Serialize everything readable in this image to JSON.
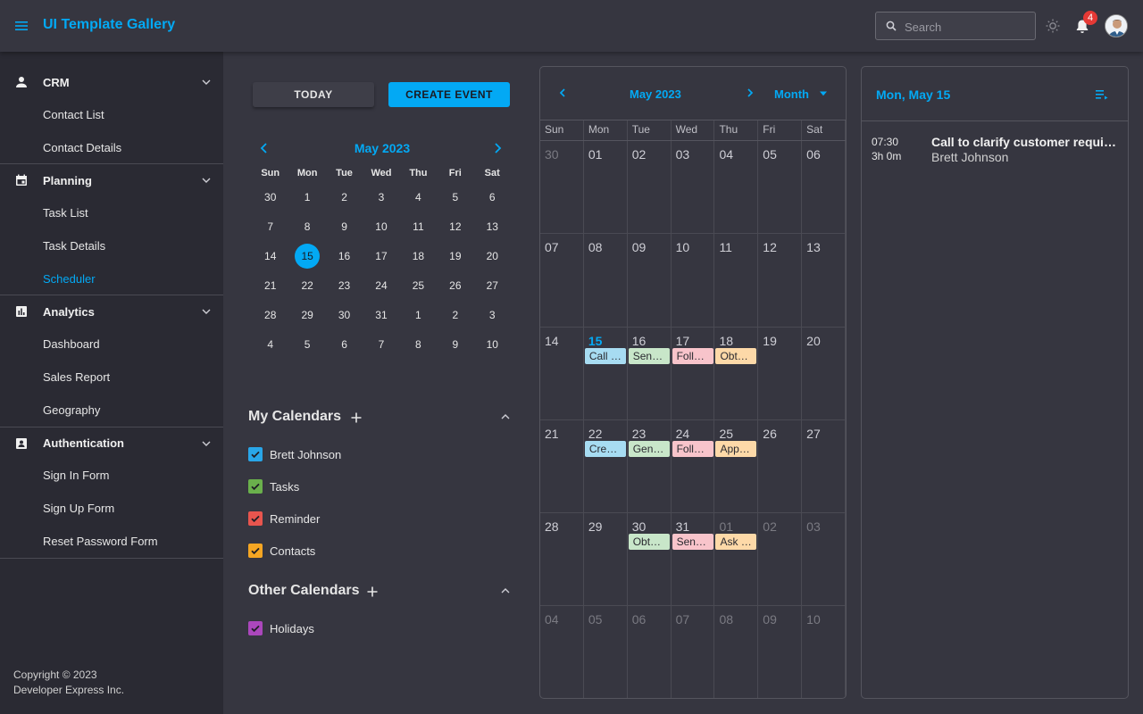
{
  "app": {
    "title": "UI Template Gallery"
  },
  "header": {
    "search_placeholder": "Search",
    "notification_count": "4"
  },
  "sidebar": {
    "groups": [
      {
        "label": "CRM",
        "icon": "person-icon",
        "items": [
          {
            "label": "Contact List"
          },
          {
            "label": "Contact Details"
          }
        ]
      },
      {
        "label": "Planning",
        "icon": "calendar-icon",
        "items": [
          {
            "label": "Task List"
          },
          {
            "label": "Task Details"
          },
          {
            "label": "Scheduler",
            "active": true
          }
        ]
      },
      {
        "label": "Analytics",
        "icon": "chart-icon",
        "items": [
          {
            "label": "Dashboard"
          },
          {
            "label": "Sales Report"
          },
          {
            "label": "Geography"
          }
        ]
      },
      {
        "label": "Authentication",
        "icon": "id-card-icon",
        "items": [
          {
            "label": "Sign In Form"
          },
          {
            "label": "Sign Up Form"
          },
          {
            "label": "Reset Password Form"
          }
        ]
      }
    ],
    "footer": {
      "line1": "Copyright © 2023",
      "line2": "Developer Express Inc."
    }
  },
  "toolbar": {
    "today_label": "TODAY",
    "create_label": "CREATE EVENT"
  },
  "mini_calendar": {
    "title": "May 2023",
    "weekdays": [
      "Sun",
      "Mon",
      "Tue",
      "Wed",
      "Thu",
      "Fri",
      "Sat"
    ],
    "weeks": [
      [
        "30",
        "1",
        "2",
        "3",
        "4",
        "5",
        "6"
      ],
      [
        "7",
        "8",
        "9",
        "10",
        "11",
        "12",
        "13"
      ],
      [
        "14",
        "15",
        "16",
        "17",
        "18",
        "19",
        "20"
      ],
      [
        "21",
        "22",
        "23",
        "24",
        "25",
        "26",
        "27"
      ],
      [
        "28",
        "29",
        "30",
        "31",
        "1",
        "2",
        "3"
      ],
      [
        "4",
        "5",
        "6",
        "7",
        "8",
        "9",
        "10"
      ]
    ],
    "selected": "15"
  },
  "my_calendars": {
    "title": "My Calendars",
    "items": [
      {
        "label": "Brett Johnson",
        "color": "#29a6e8"
      },
      {
        "label": "Tasks",
        "color": "#6ab04c"
      },
      {
        "label": "Reminder",
        "color": "#e8554e"
      },
      {
        "label": "Contacts",
        "color": "#f5a623"
      }
    ]
  },
  "other_calendars": {
    "title": "Other Calendars",
    "items": [
      {
        "label": "Holidays",
        "color": "#ab47bc"
      }
    ]
  },
  "month_view": {
    "title": "May 2023",
    "view_label": "Month",
    "weekdays": [
      "Sun",
      "Mon",
      "Tue",
      "Wed",
      "Thu",
      "Fri",
      "Sat"
    ],
    "weeks": [
      [
        {
          "d": "30",
          "o": true
        },
        {
          "d": "01"
        },
        {
          "d": "02"
        },
        {
          "d": "03"
        },
        {
          "d": "04"
        },
        {
          "d": "05"
        },
        {
          "d": "06"
        }
      ],
      [
        {
          "d": "07"
        },
        {
          "d": "08"
        },
        {
          "d": "09"
        },
        {
          "d": "10"
        },
        {
          "d": "11"
        },
        {
          "d": "12"
        },
        {
          "d": "13"
        }
      ],
      [
        {
          "d": "14"
        },
        {
          "d": "15",
          "t": true,
          "ev": {
            "text": "Call …",
            "color": "#a7dcf2"
          }
        },
        {
          "d": "16",
          "ev": {
            "text": "Sen…",
            "color": "#c8e6c9"
          }
        },
        {
          "d": "17",
          "ev": {
            "text": "Foll…",
            "color": "#f8c4cb"
          }
        },
        {
          "d": "18",
          "ev": {
            "text": "Obt…",
            "color": "#fdd9a8"
          }
        },
        {
          "d": "19"
        },
        {
          "d": "20"
        }
      ],
      [
        {
          "d": "21"
        },
        {
          "d": "22",
          "ev": {
            "text": "Cre…",
            "color": "#a7dcf2"
          }
        },
        {
          "d": "23",
          "ev": {
            "text": "Gen…",
            "color": "#c8e6c9"
          }
        },
        {
          "d": "24",
          "ev": {
            "text": "Foll…",
            "color": "#f8c4cb"
          }
        },
        {
          "d": "25",
          "ev": {
            "text": "App…",
            "color": "#fdd9a8"
          }
        },
        {
          "d": "26"
        },
        {
          "d": "27"
        }
      ],
      [
        {
          "d": "28"
        },
        {
          "d": "29"
        },
        {
          "d": "30",
          "ev": {
            "text": "Obt…",
            "color": "#c8e6c9"
          }
        },
        {
          "d": "31",
          "ev": {
            "text": "Sen…",
            "color": "#f8c4cb"
          }
        },
        {
          "d": "01",
          "o": true,
          "ev": {
            "text": "Ask …",
            "color": "#fdd9a8"
          }
        },
        {
          "d": "02",
          "o": true
        },
        {
          "d": "03",
          "o": true
        }
      ],
      [
        {
          "d": "04",
          "o": true
        },
        {
          "d": "05",
          "o": true
        },
        {
          "d": "06",
          "o": true
        },
        {
          "d": "07",
          "o": true
        },
        {
          "d": "08",
          "o": true
        },
        {
          "d": "09",
          "o": true
        },
        {
          "d": "10",
          "o": true
        }
      ]
    ]
  },
  "agenda": {
    "title": "Mon, May 15",
    "items": [
      {
        "time": "07:30",
        "duration": "3h 0m",
        "subject": "Call to clarify customer requirements",
        "person": "Brett Johnson"
      }
    ]
  }
}
